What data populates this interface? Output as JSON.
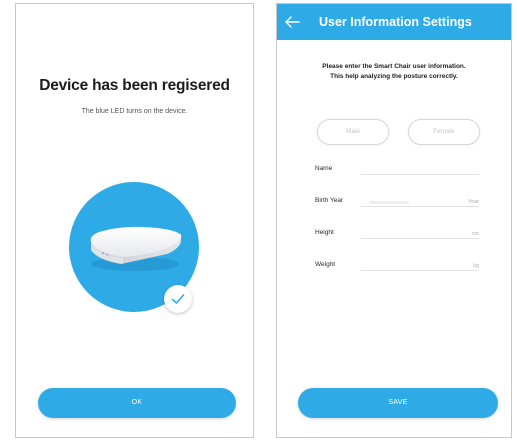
{
  "registered_screen": {
    "title": "Device has been regisered",
    "subtitle": "The blue LED turns on the device.",
    "ok_label": "OK"
  },
  "settings_screen": {
    "header_title": "User Information Settings",
    "intro_line1": "Please enter the Smart Chair user information.",
    "intro_line2": "This help analyzing the posture correctly.",
    "gender": {
      "male_label": "Male",
      "female_label": "Female"
    },
    "fields": {
      "name_label": "Name",
      "birth_year_label": "Birth Year",
      "birth_year_unit": "Year",
      "height_label": "Height",
      "height_unit": "cm",
      "weight_label": "Weight",
      "weight_unit": "kg"
    },
    "save_label": "SAVE"
  },
  "colors": {
    "accent": "#2eabe7",
    "text_dark": "#1c1c1c",
    "placeholder": "#c4c4c4"
  },
  "icons": {
    "back": "back-arrow-icon",
    "check": "checkmark-icon",
    "device": "smart-chair-sensor-icon"
  }
}
